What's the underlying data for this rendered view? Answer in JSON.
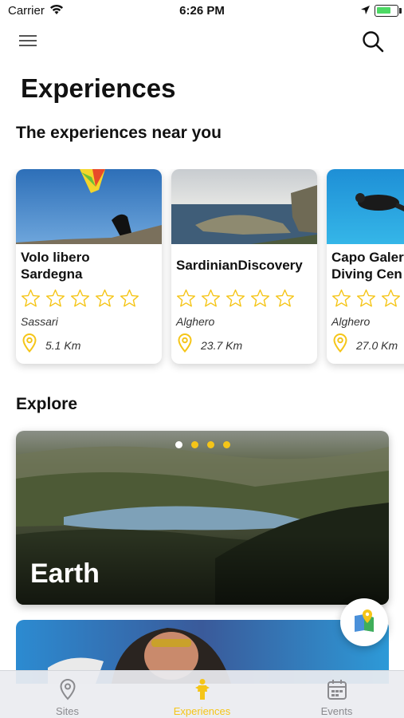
{
  "status_bar": {
    "carrier": "Carrier",
    "time": "6:26 PM",
    "battery_level": 0.7
  },
  "header": {
    "title": "Experiences",
    "menu_icon": "hamburger-menu-icon",
    "search_icon": "search-icon"
  },
  "nearby": {
    "title": "The experiences near you",
    "items": [
      {
        "name": "Volo libero\nSardegna",
        "rating": 0,
        "max_rating": 5,
        "city": "Sassari",
        "distance": "5.1 Km"
      },
      {
        "name": "SardinianDiscovery",
        "rating": 0,
        "max_rating": 5,
        "city": "Alghero",
        "distance": "23.7 Km"
      },
      {
        "name": "Capo Galer\nDiving Cen",
        "rating": 0,
        "max_rating": 5,
        "city": "Alghero",
        "distance": "27.0 Km"
      }
    ]
  },
  "explore": {
    "title": "Explore",
    "banner_label": "Earth",
    "page_count": 4,
    "active_page": 1,
    "map_button_icon": "map-pin-icon"
  },
  "tab_bar": {
    "tabs": [
      {
        "label": "Sites",
        "icon": "location-pin-icon",
        "active": false
      },
      {
        "label": "Experiences",
        "icon": "person-icon",
        "active": true
      },
      {
        "label": "Events",
        "icon": "calendar-icon",
        "active": false
      }
    ]
  },
  "colors": {
    "accent": "#f5c518",
    "inactive": "#8a8a8e",
    "star_outline": "#f5c518"
  }
}
